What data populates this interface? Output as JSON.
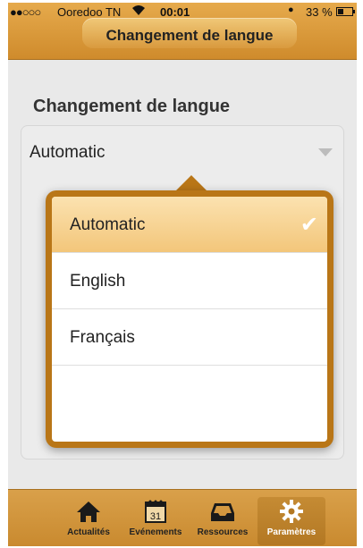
{
  "status_bar": {
    "signal": "●●○○○",
    "carrier": "Ooredoo TN",
    "wifi": "wifi-icon",
    "time": "00:01",
    "alarm": "alarm-icon",
    "battery_percent": "33 %"
  },
  "header": {
    "title": "Changement de langue"
  },
  "section": {
    "title": "Changement de langue"
  },
  "select": {
    "value": "Automatic"
  },
  "popover": {
    "options": [
      {
        "label": "Automatic",
        "selected": true
      },
      {
        "label": "English",
        "selected": false
      },
      {
        "label": "Français",
        "selected": false
      }
    ],
    "check": "✔"
  },
  "tabbar": {
    "tabs": [
      {
        "label": "Actualités",
        "icon": "home-icon"
      },
      {
        "label": "Evénements",
        "icon": "calendar-icon",
        "calendar_day": "31"
      },
      {
        "label": "Ressources",
        "icon": "inbox-icon"
      },
      {
        "label": "Paramètres",
        "icon": "gear-icon",
        "active": true
      }
    ]
  },
  "colors": {
    "accent": "#cf8b2c",
    "popover": "#b97617",
    "selected_row": "#f3c67a"
  }
}
